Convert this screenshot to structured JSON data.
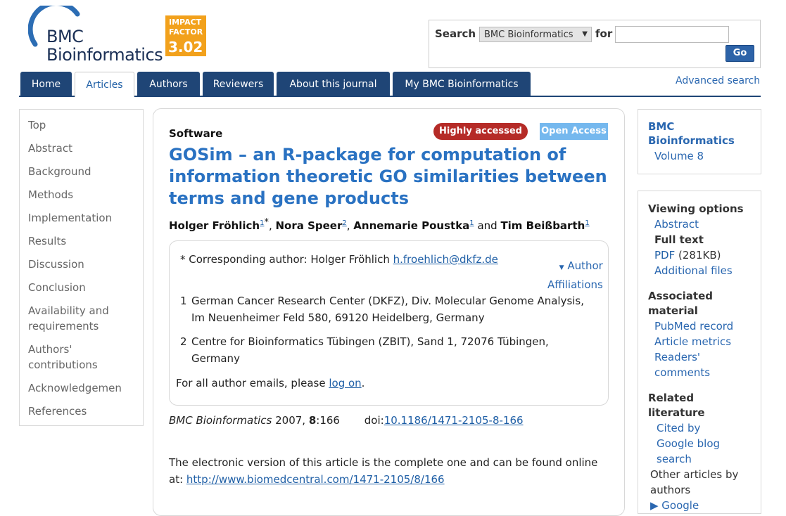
{
  "logo": {
    "line1": "BMC",
    "line2": "Bioinformatics"
  },
  "impact": {
    "line1": "IMPACT",
    "line2": "FACTOR",
    "value": "3.02"
  },
  "search": {
    "label": "Search",
    "scope": "BMC Bioinformatics",
    "for_label": "for",
    "input_value": "",
    "go_label": "Go",
    "advanced_label": "Advanced search"
  },
  "nav": {
    "tabs": [
      "Home",
      "Articles",
      "Authors",
      "Reviewers",
      "About this journal",
      "My BMC Bioinformatics"
    ],
    "active": "Articles"
  },
  "left_nav": [
    "Top",
    "Abstract",
    "Background",
    "Methods",
    "Implementation",
    "Results",
    "Discussion",
    "Conclusion",
    "Availability and",
    "requirements",
    "Authors'",
    "contributions",
    "Acknowledgemen",
    "References"
  ],
  "article": {
    "type": "Software",
    "badge_highly": "Highly accessed",
    "badge_open": "Open Access",
    "title_lines": [
      "GOSim – an R-package for computation of",
      "information theoretic GO similarities between",
      "terms and gene products"
    ],
    "authors": [
      {
        "name": "Holger Fröhlich",
        "aff": "1",
        "extra": "*"
      },
      {
        "name": "Nora Speer",
        "aff": "2"
      },
      {
        "name": "Annemarie Poustka",
        "aff": "1"
      },
      {
        "name": "Tim Beißbarth",
        "aff": "1"
      }
    ],
    "authors_sep": ", ",
    "authors_and": " and ",
    "corresponding_prefix": "* Corresponding author: Holger Fröhlich",
    "corresponding_email": "h.froehlich@dkfz.de",
    "affiliations_toggle": [
      "Author",
      "Affiliations"
    ],
    "affiliations": [
      {
        "num": "1",
        "lines": [
          "German Cancer Research Center (DKFZ), Div. Molecular Genome Analysis,",
          "Im Neuenheimer Feld 580, 69120 Heidelberg, Germany"
        ]
      },
      {
        "num": "2",
        "lines": [
          "Centre for Bioinformatics Tübingen (ZBIT), Sand 1, 72076 Tübingen,",
          "Germany"
        ]
      }
    ],
    "emails_prefix": "For all author emails, please ",
    "emails_link": "log on",
    "emails_suffix": ".",
    "citation": {
      "journal": "BMC Bioinformatics",
      "year": "2007",
      "volume": "8",
      "pages": "166",
      "doi_label": "doi:",
      "doi": "10.1186/1471-2105-8-166"
    },
    "note_line1": "The electronic version of this article is the complete one and can be found online",
    "note_prefix": "at: ",
    "note_url": "http://www.biomedcentral.com/1471-2105/8/166"
  },
  "sidebar": {
    "journal_lines": [
      "BMC",
      "Bioinformatics"
    ],
    "volume": "Volume 8",
    "viewing_title": "Viewing options",
    "abstract": "Abstract",
    "full_text": "Full text",
    "pdf": "PDF",
    "pdf_size": " (281KB)",
    "additional_files": "Additional files",
    "associated_lines": [
      "Associated",
      "material"
    ],
    "pubmed": "PubMed record",
    "metrics": "Article metrics",
    "readers_lines": [
      "Readers'",
      "comments"
    ],
    "related_lines": [
      "Related",
      "literature"
    ],
    "cited_by": "Cited by",
    "google_blog_lines": [
      "Google blog",
      "search"
    ],
    "other_lines": [
      "Other articles by",
      "authors"
    ],
    "more": "▶ Google"
  },
  "colors": {
    "nav": "#1f4576",
    "link": "#1f5fa6",
    "title": "#2a72c2",
    "impact": "#f2a11c",
    "highly_accessed": "#b52b27",
    "open_access": "#75b8ee"
  }
}
